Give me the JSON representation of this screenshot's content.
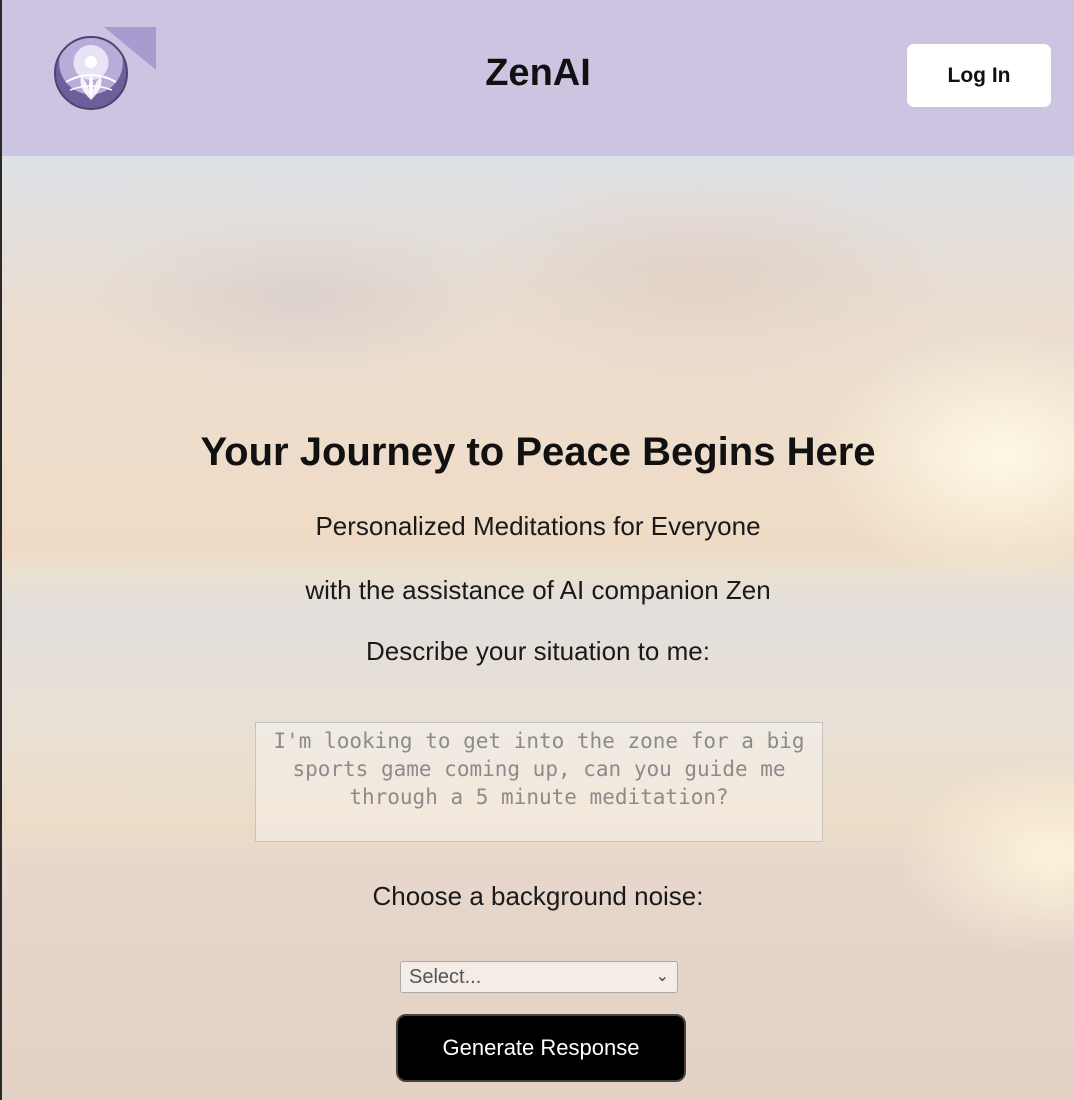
{
  "header": {
    "app_title": "ZenAI",
    "login_label": "Log In",
    "logo_icon": "lotus-sunrise-logo"
  },
  "hero": {
    "headline": "Your Journey to Peace Begins Here",
    "subtitle": "Personalized Meditations for Everyone",
    "tagline": "with the assistance of AI companion Zen",
    "situation_prompt": "Describe your situation to me:",
    "situation_placeholder": "I'm looking to get into the zone for a big sports game coming up, can you guide me through a 5 minute meditation?",
    "noise_prompt": "Choose a background noise:",
    "noise_selected": "Select...",
    "generate_label": "Generate Response"
  },
  "colors": {
    "header_bg": "#cdc4e2",
    "button_dark": "#000000",
    "button_light": "#ffffff"
  }
}
